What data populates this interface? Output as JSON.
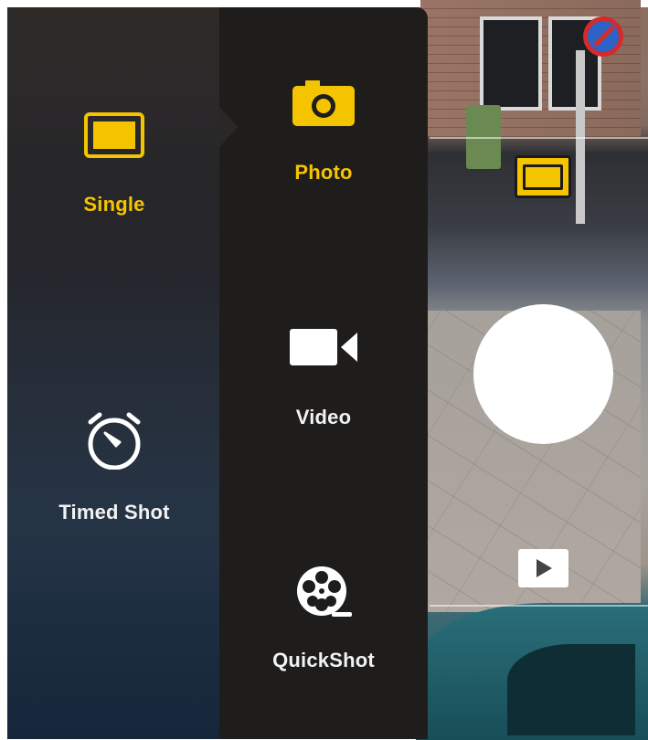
{
  "modes": {
    "single": {
      "label": "Single",
      "icon": "single-frame-icon",
      "selected": true
    },
    "timed_shot": {
      "label": "Timed Shot",
      "icon": "timer-icon",
      "selected": false
    }
  },
  "submodes": {
    "photo": {
      "label": "Photo",
      "icon": "camera-icon",
      "selected": true
    },
    "video": {
      "label": "Video",
      "icon": "video-camera-icon",
      "selected": false
    },
    "quickshot": {
      "label": "QuickShot",
      "icon": "film-reel-icon",
      "selected": false
    }
  },
  "controls": {
    "shutter": "shutter-button",
    "playback": "play-icon",
    "current_mode_indicator": "single-frame-icon"
  },
  "colors": {
    "accent": "#f5c400",
    "text": "#f2f2f2",
    "panel": "#1e1d1c"
  }
}
